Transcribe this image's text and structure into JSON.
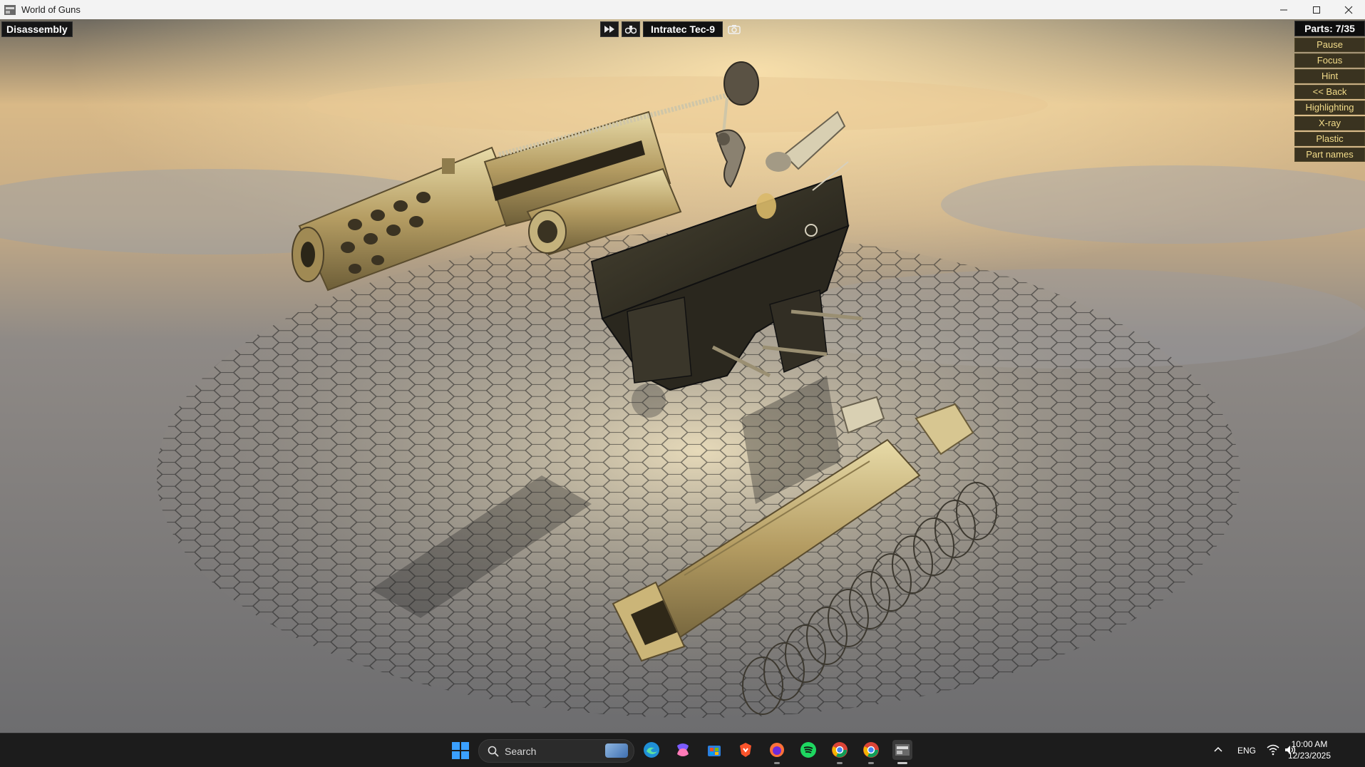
{
  "window": {
    "title": "World of Guns",
    "controls": [
      "minimize-icon",
      "maximize-icon",
      "close-icon"
    ]
  },
  "hud": {
    "mode": "Disassembly",
    "weapon_name": "Intratec Tec-9",
    "left_buttons": [
      "fast-forward-icon",
      "binoculars-icon"
    ],
    "camera_button": "camera-icon"
  },
  "panel": {
    "parts": "Parts: 7/35",
    "buttons": [
      {
        "label": "Pause"
      },
      {
        "label": "Focus"
      },
      {
        "label": "Hint"
      },
      {
        "label": "<< Back"
      },
      {
        "label": "Highlighting"
      },
      {
        "label": "X-ray"
      },
      {
        "label": "Plastic"
      },
      {
        "label": "Part names"
      }
    ]
  },
  "taskbar": {
    "search_placeholder": "Search",
    "apps": [
      "windows-start-icon",
      "edge-icon",
      "copilot-icon",
      "store-icon",
      "brave-icon",
      "firefox-icon",
      "spotify-icon",
      "chrome-icon",
      "chrome-profile-icon",
      "world-of-guns-icon"
    ],
    "language": "ENG",
    "time": "10:00 AM",
    "date": "12/23/2025"
  },
  "colors": {
    "panel_button_bg": "#3a3320",
    "panel_button_text": "#f3dc8a",
    "brass": "#c9b37a",
    "frame": "#2e2b22"
  }
}
